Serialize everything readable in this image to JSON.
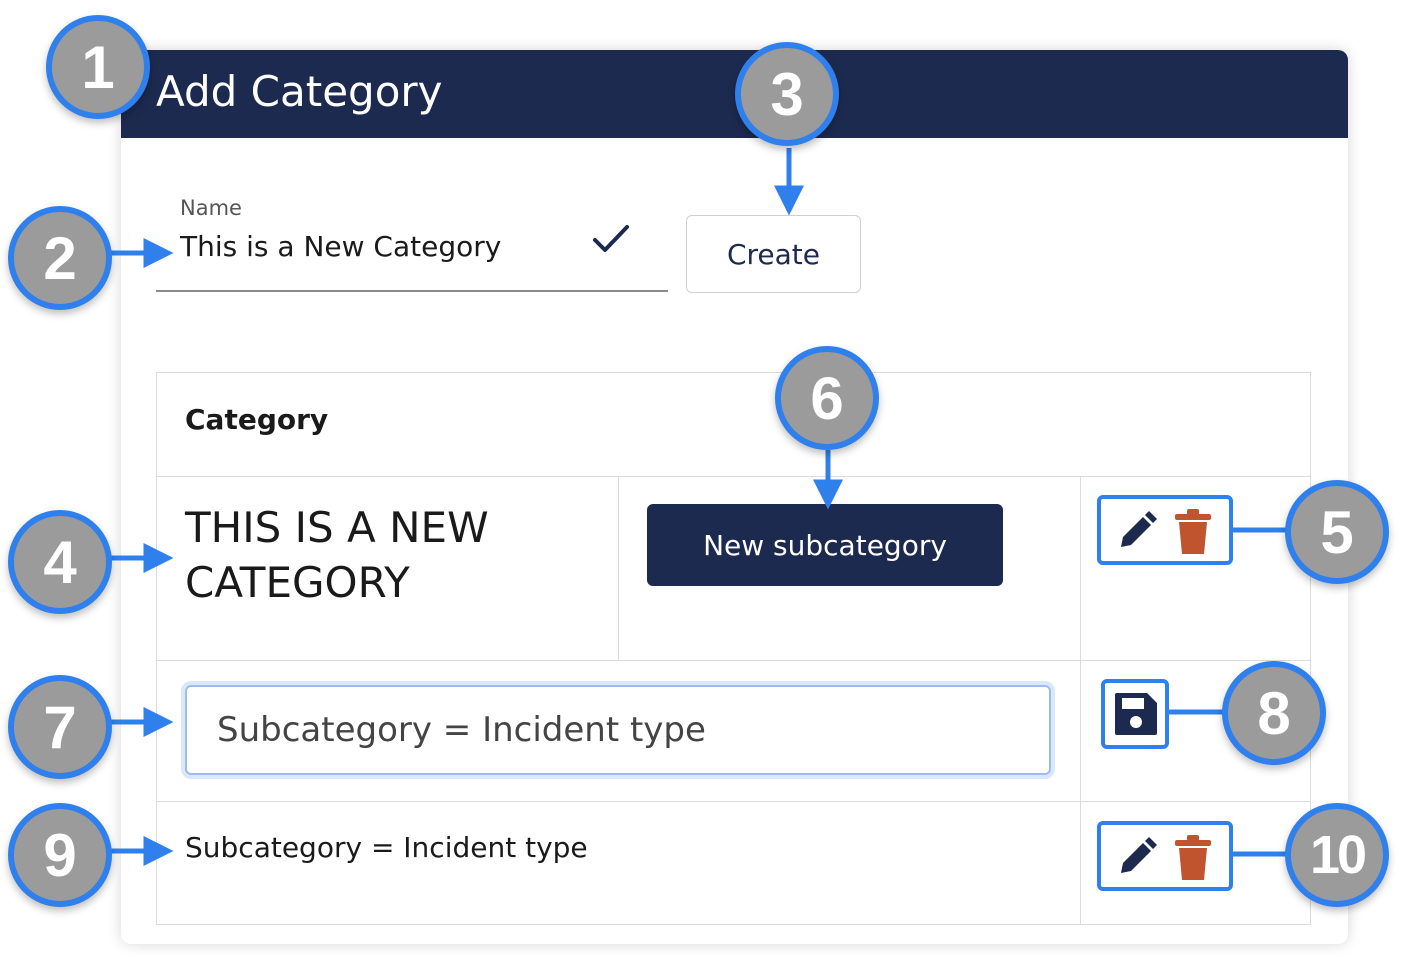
{
  "dialog": {
    "title": "Add Category",
    "name_label": "Name",
    "name_value": "This is a New Category",
    "create_label": "Create"
  },
  "table": {
    "heading": "Category",
    "category_name": "THIS IS A NEW CATEGORY",
    "new_subcategory_label": "New subcategory",
    "subcategory_input_value": "Subcategory = Incident type",
    "subcategory_row_text": "Subcategory = Incident type"
  },
  "callouts": [
    "1",
    "2",
    "3",
    "4",
    "5",
    "6",
    "7",
    "8",
    "9",
    "10"
  ],
  "icons": {
    "name_valid": "checkmark-icon",
    "edit": "pencil-icon",
    "delete": "trash-icon",
    "save": "floppy-disk-icon"
  },
  "colors": {
    "header": "#1d2a4f",
    "primary_button": "#1d2a4f",
    "callout_border": "#2f80ed",
    "callout_fill": "#9b9b9b",
    "delete_icon": "#c0542e"
  }
}
